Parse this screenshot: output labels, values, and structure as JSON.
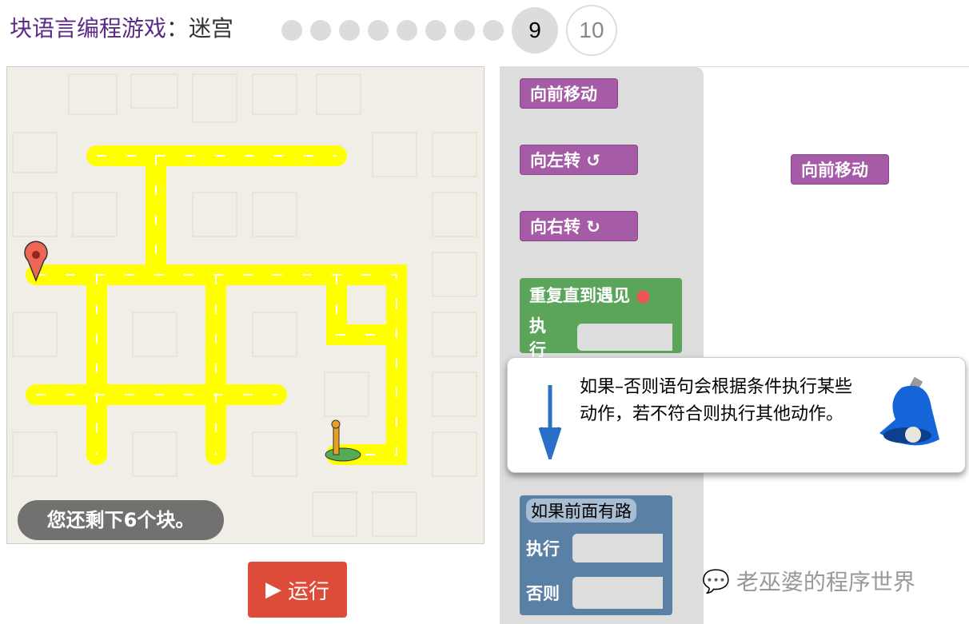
{
  "header": {
    "title_app": "块语言编程游戏",
    "title_sep": "：",
    "title_game": "迷宫",
    "completed_levels": 8,
    "current_level": "9",
    "next_level": "10"
  },
  "maze": {
    "remaining": "您还剩下6个块。",
    "run_label": "运行",
    "path_color": "#ffff00"
  },
  "toolbox": {
    "move_forward": "向前移动",
    "turn_left": "向左转 ↺",
    "turn_right": "向右转 ↻",
    "repeat_until": "重复直到遇见",
    "do": "执行",
    "if_path": "如果前面有路",
    "else": "否则"
  },
  "workspace": {
    "block": "向前移动"
  },
  "tooltip": {
    "text": "如果–否则语句会根据条件执行某些动作，若不符合则执行其他动作。"
  },
  "watermark": "老巫婆的程序世界"
}
